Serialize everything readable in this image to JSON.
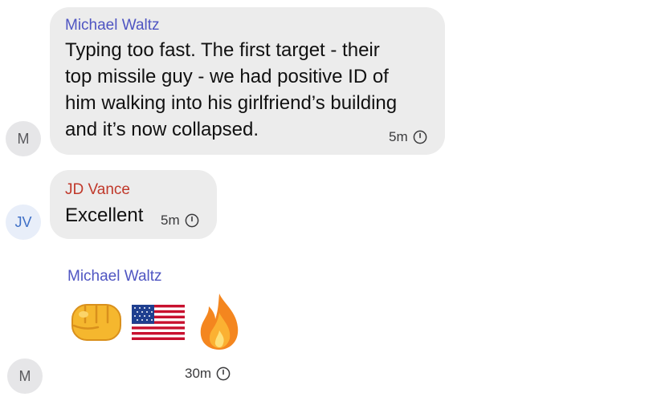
{
  "messages": [
    {
      "sender": "Michael Waltz",
      "avatar": "M",
      "lines": [
        "Typing too fast. The first target - their",
        "top missile guy - we had positive ID of",
        "him walking into his girlfriend’s building",
        "and it’s now collapsed."
      ],
      "time": "5m"
    },
    {
      "sender": "JD Vance",
      "avatar": "JV",
      "text": "Excellent",
      "time": "5m"
    },
    {
      "sender": "Michael Waltz",
      "avatar": "M",
      "emojis": [
        "oncoming-fist-emoji",
        "us-flag-emoji",
        "fire-emoji"
      ],
      "time": "30m"
    }
  ],
  "colors": {
    "bubble": "#ececec",
    "sender_purple": "#4f55c2",
    "sender_red": "#c0392b",
    "avatar_gray_bg": "#e6e6e8",
    "avatar_blue_bg": "#e8eef9",
    "avatar_blue_text": "#3e6fc6"
  },
  "icons": [
    "clock-icon",
    "oncoming-fist-emoji",
    "us-flag-emoji",
    "fire-emoji"
  ]
}
